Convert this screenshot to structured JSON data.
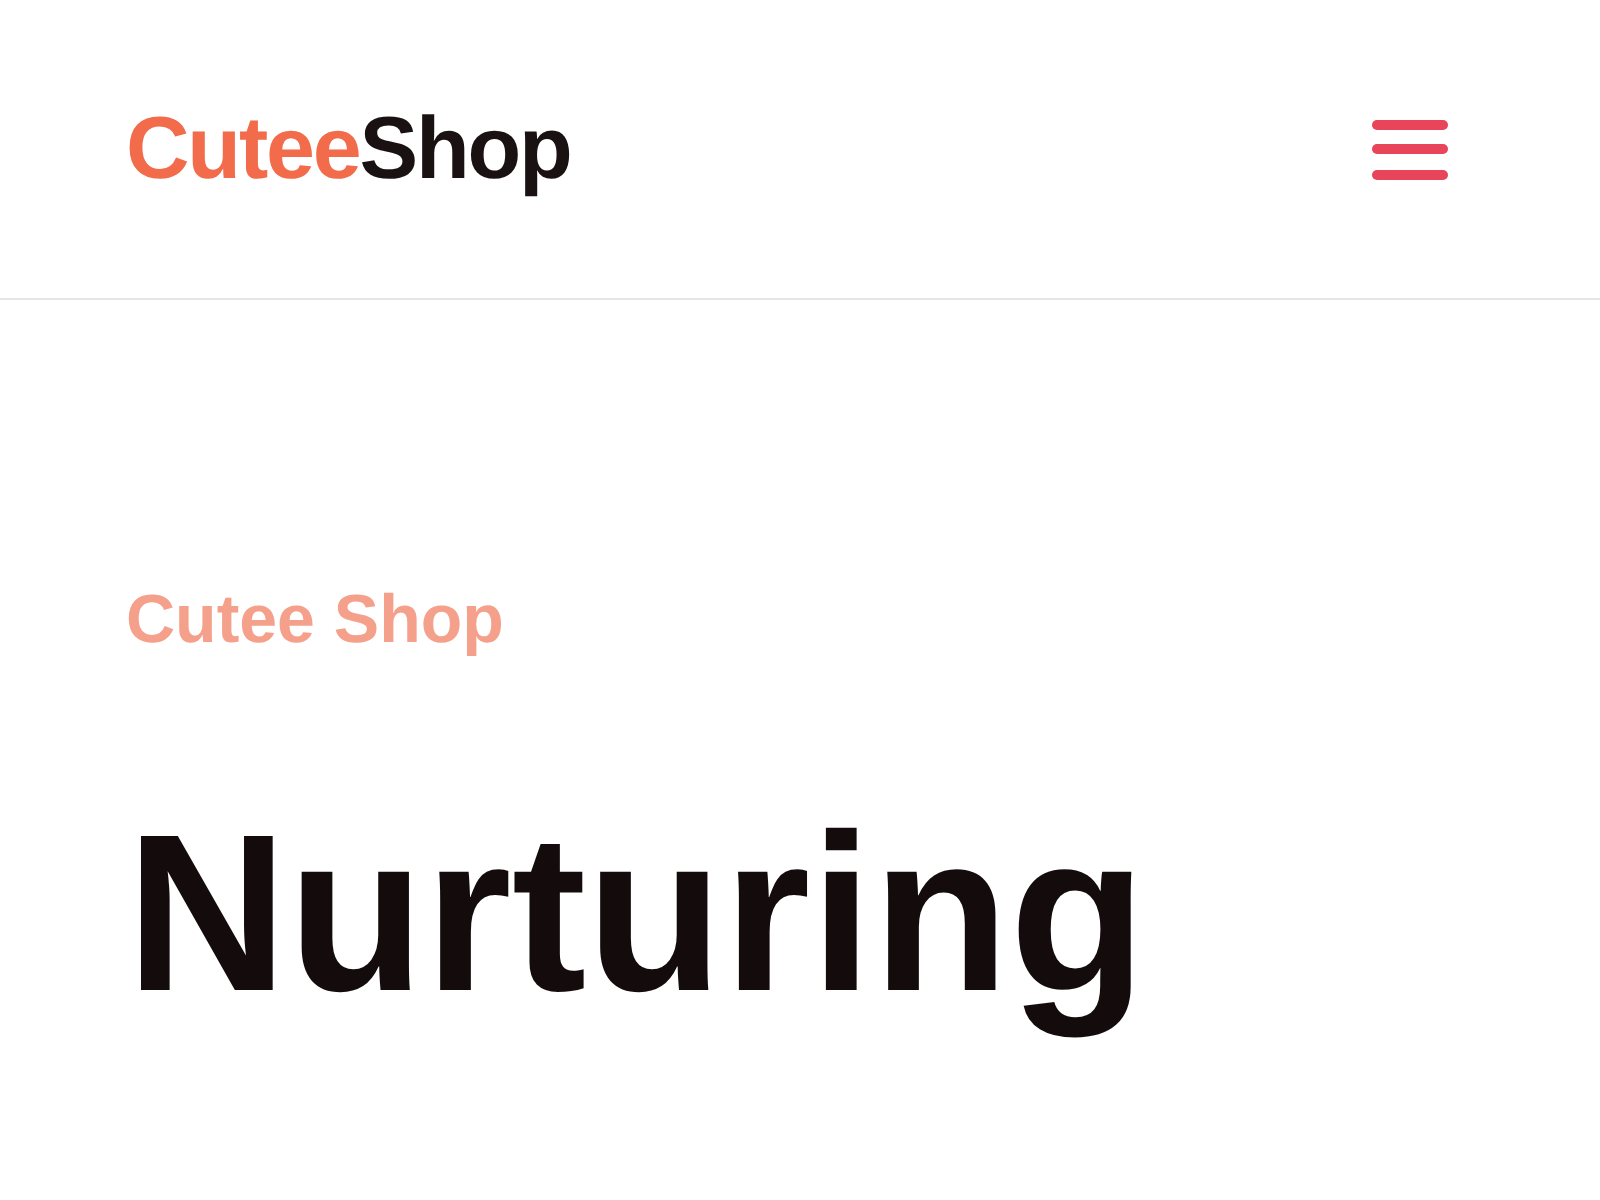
{
  "header": {
    "logo": {
      "accent": "Cutee",
      "rest": "Shop"
    }
  },
  "hero": {
    "eyebrow": "Cutee Shop",
    "heading": "Nurturing"
  }
}
